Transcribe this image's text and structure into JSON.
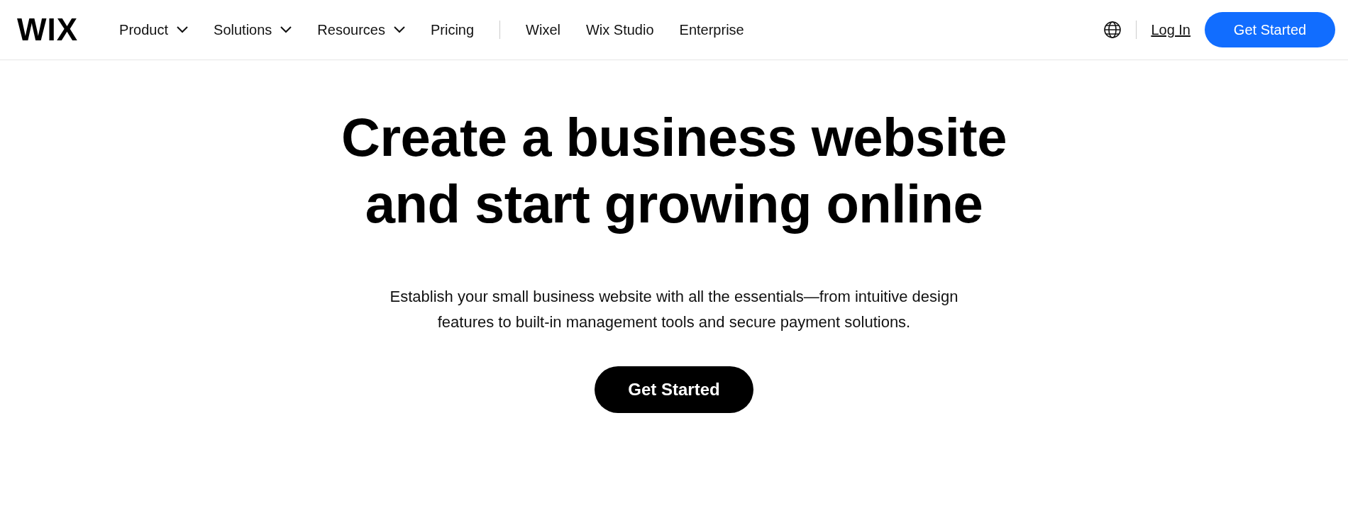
{
  "header": {
    "logo": "WIX",
    "nav": [
      {
        "label": "Product",
        "kind": "menu"
      },
      {
        "label": "Solutions",
        "kind": "menu"
      },
      {
        "label": "Resources",
        "kind": "menu"
      },
      {
        "label": "Pricing",
        "kind": "link"
      },
      {
        "label": "Wixel",
        "kind": "link",
        "divider_before": true
      },
      {
        "label": "Wix Studio",
        "kind": "link"
      },
      {
        "label": "Enterprise",
        "kind": "link"
      }
    ],
    "login": "Log In",
    "cta": "Get Started"
  },
  "hero": {
    "title_lines": [
      "Create a business website",
      "and start growing online"
    ],
    "subtitle_lines": [
      "Establish your small business website with all the essentials—from intuitive design",
      "features to built-in management tools and secure payment solutions."
    ],
    "cta": "Get Started"
  }
}
